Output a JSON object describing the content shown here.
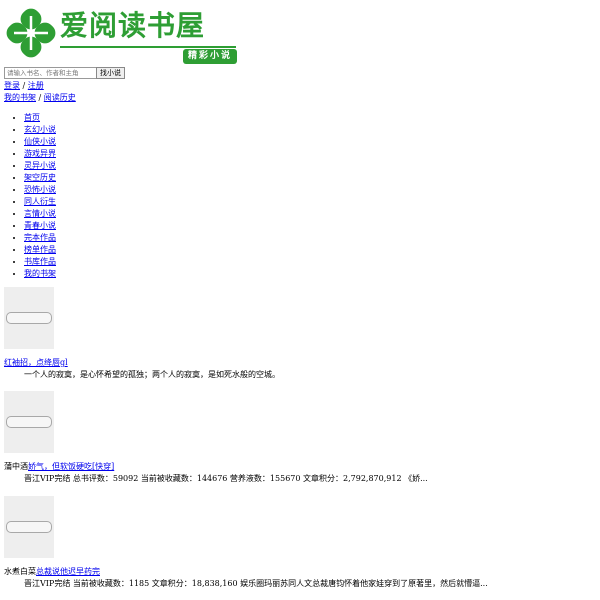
{
  "site": {
    "logo_text": "爱阅读书屋",
    "logo_tag": "精彩小说"
  },
  "search": {
    "placeholder": "请输入书名、作者和主角",
    "button_label": "找小说"
  },
  "auth": {
    "login": "登录",
    "separator": "/",
    "register": "注册"
  },
  "shelf": {
    "bookshelf": "我的书架",
    "separator": "/",
    "history": "阅读历史"
  },
  "nav": {
    "items": [
      "首页",
      "玄幻小说",
      "仙侠小说",
      "游戏异界",
      "灵异小说",
      "架空历史",
      "恐怖小说",
      "同人衍生",
      "言情小说",
      "青春小说",
      "完本作品",
      "榜单作品",
      "书库作品",
      "我的书架"
    ]
  },
  "books": [
    {
      "prefix": "",
      "title": "红袖招，点绛唇gl",
      "desc": "一个人的寂寞，是心怀希望的孤独；两个人的寂寞，是如死水般的空城。"
    },
    {
      "prefix": "蒲中酒",
      "title": "娇气，但软饭硬吃[快穿]",
      "desc": "晋江VIP完结 总书评数：59092 当前被收藏数：144676 营养液数：155670 文章积分：2,792,870,912 《娇..."
    },
    {
      "prefix": "水煮白菜",
      "title": "总裁说他迟早药完",
      "desc": "晋江VIP完结 当前被收藏数：1185 文章积分：18,838,160 娱乐圈玛丽苏同人文总裁唐钧怀着他家娃穿到了原著里，然后就懵逼..."
    }
  ]
}
